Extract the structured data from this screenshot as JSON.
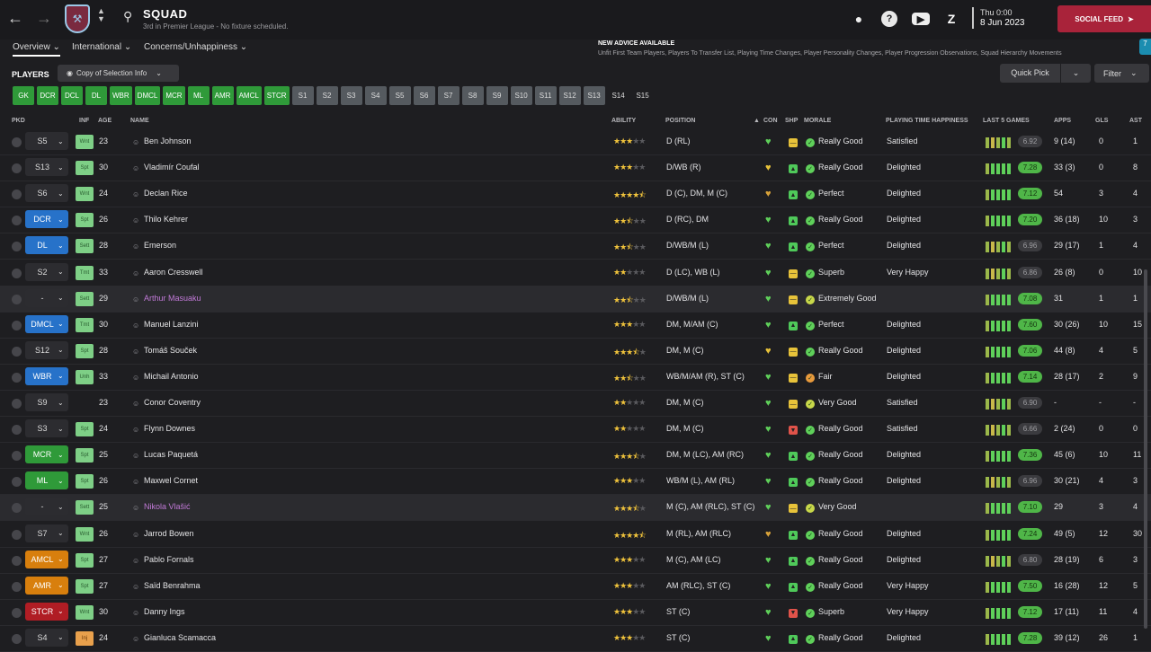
{
  "header": {
    "title": "SQUAD",
    "subtitle": "3rd in Premier League - No fixture scheduled.",
    "date_day": "Thu 0:00",
    "date_full": "8 Jun 2023",
    "social_feed": "SOCIAL FEED"
  },
  "tabs": [
    {
      "label": "Overview"
    },
    {
      "label": "International"
    },
    {
      "label": "Concerns/Unhappiness"
    }
  ],
  "advice": {
    "title": "NEW ADVICE AVAILABLE",
    "text": "Unfit First Team Players, Players To Transfer List, Playing Time Changes, Player Personality Changes, Player Progression Observations, Squad Hierarchy Movements",
    "count": "7"
  },
  "toolbar": {
    "players_label": "PLAYERS",
    "copy_label": "Copy of Selection Info",
    "quick_pick": "Quick Pick",
    "filter": "Filter"
  },
  "chips": [
    "GK",
    "DCR",
    "DCL",
    "DL",
    "WBR",
    "DMCL",
    "MCR",
    "ML",
    "AMR",
    "AMCL",
    "STCR",
    "S1",
    "S2",
    "S3",
    "S4",
    "S5",
    "S6",
    "S7",
    "S8",
    "S9",
    "S10",
    "S11",
    "S12",
    "S13",
    "S14",
    "S15"
  ],
  "columns": {
    "pkd": "PKD",
    "inf": "INF",
    "age": "AGE",
    "name": "NAME",
    "ability": "ABILITY",
    "position": "POSITION",
    "con": "CON",
    "shp": "SHP",
    "morale": "MORALE",
    "pth": "PLAYING TIME HAPPINESS",
    "last5": "LAST 5 GAMES",
    "apps": "APPS",
    "gls": "GLS",
    "ast": "AST"
  },
  "players": [
    {
      "pkd": "S5",
      "inf": "Wnt",
      "age": "23",
      "name": "Ben Johnson",
      "stars": 3,
      "position": "D (RL)",
      "morale": "Really Good",
      "pth": "Satisfied",
      "rating": "6.92",
      "apps": "9 (14)",
      "gls": "0",
      "ast": "1"
    },
    {
      "pkd": "S13",
      "inf": "Spt",
      "age": "30",
      "name": "Vladimír Coufal",
      "stars": 3,
      "position": "D/WB (R)",
      "morale": "Really Good",
      "pth": "Delighted",
      "rating": "7.28",
      "apps": "33 (3)",
      "gls": "0",
      "ast": "8"
    },
    {
      "pkd": "S6",
      "inf": "Wnt",
      "age": "24",
      "name": "Declan Rice",
      "stars": 4.5,
      "position": "D (C), DM, M (C)",
      "morale": "Perfect",
      "pth": "Delighted",
      "rating": "7.12",
      "apps": "54",
      "gls": "3",
      "ast": "4"
    },
    {
      "pkd": "DCR",
      "inf": "Spt",
      "age": "26",
      "name": "Thilo Kehrer",
      "stars": 2.5,
      "position": "D (RC), DM",
      "morale": "Really Good",
      "pth": "Delighted",
      "rating": "7.20",
      "apps": "36 (18)",
      "gls": "10",
      "ast": "3"
    },
    {
      "pkd": "DL",
      "inf": "Sett",
      "age": "28",
      "name": "Emerson",
      "stars": 2.5,
      "position": "D/WB/M (L)",
      "morale": "Perfect",
      "pth": "Delighted",
      "rating": "6.96",
      "apps": "29 (17)",
      "gls": "1",
      "ast": "4"
    },
    {
      "pkd": "S2",
      "inf": "Tmt",
      "age": "33",
      "name": "Aaron Cresswell",
      "stars": 2,
      "position": "D (LC), WB (L)",
      "morale": "Superb",
      "pth": "Very Happy",
      "rating": "6.86",
      "apps": "26 (8)",
      "gls": "0",
      "ast": "10"
    },
    {
      "pkd": "-",
      "inf": "Sett",
      "age": "29",
      "name": "Arthur Masuaku",
      "stars": 2.5,
      "position": "D/WB/M (L)",
      "morale": "Extremely Good",
      "pth": "",
      "rating": "7.08",
      "apps": "31",
      "gls": "1",
      "ast": "1"
    },
    {
      "pkd": "DMCL",
      "inf": "Tmt",
      "age": "30",
      "name": "Manuel Lanzini",
      "stars": 3,
      "position": "DM, M/AM (C)",
      "morale": "Perfect",
      "pth": "Delighted",
      "rating": "7.60",
      "apps": "30 (26)",
      "gls": "10",
      "ast": "15"
    },
    {
      "pkd": "S12",
      "inf": "Spt",
      "age": "28",
      "name": "Tomáš Souček",
      "stars": 3.5,
      "position": "DM, M (C)",
      "morale": "Really Good",
      "pth": "Delighted",
      "rating": "7.06",
      "apps": "44 (8)",
      "gls": "4",
      "ast": "5"
    },
    {
      "pkd": "WBR",
      "inf": "Unh",
      "age": "33",
      "name": "Michail Antonio",
      "stars": 2.5,
      "position": "WB/M/AM (R), ST (C)",
      "morale": "Fair",
      "pth": "Delighted",
      "rating": "7.14",
      "apps": "28 (17)",
      "gls": "2",
      "ast": "9"
    },
    {
      "pkd": "S9",
      "inf": "",
      "age": "23",
      "name": "Conor Coventry",
      "stars": 2,
      "position": "DM, M (C)",
      "morale": "Very Good",
      "pth": "Satisfied",
      "rating": "6.90",
      "apps": "-",
      "gls": "-",
      "ast": "-"
    },
    {
      "pkd": "S3",
      "inf": "Spt",
      "age": "24",
      "name": "Flynn Downes",
      "stars": 2,
      "position": "DM, M (C)",
      "morale": "Really Good",
      "pth": "Satisfied",
      "rating": "6.66",
      "apps": "2 (24)",
      "gls": "0",
      "ast": "0"
    },
    {
      "pkd": "MCR",
      "inf": "Spt",
      "age": "25",
      "name": "Lucas Paquetá",
      "stars": 3.5,
      "position": "DM, M (LC), AM (RC)",
      "morale": "Really Good",
      "pth": "Delighted",
      "rating": "7.36",
      "apps": "45 (6)",
      "gls": "10",
      "ast": "11"
    },
    {
      "pkd": "ML",
      "inf": "Spt",
      "age": "26",
      "name": "Maxwel Cornet",
      "stars": 3,
      "position": "WB/M (L), AM (RL)",
      "morale": "Really Good",
      "pth": "Delighted",
      "rating": "6.96",
      "apps": "30 (21)",
      "gls": "4",
      "ast": "3"
    },
    {
      "pkd": "-",
      "inf": "Sett",
      "age": "25",
      "name": "Nikola Vlašić",
      "stars": 3.5,
      "position": "M (C), AM (RLC), ST (C)",
      "morale": "Very Good",
      "pth": "",
      "rating": "7.10",
      "apps": "29",
      "gls": "3",
      "ast": "4"
    },
    {
      "pkd": "S7",
      "inf": "Wnt",
      "age": "26",
      "name": "Jarrod Bowen",
      "stars": 4.5,
      "position": "M (RL), AM (RLC)",
      "morale": "Really Good",
      "pth": "Delighted",
      "rating": "7.24",
      "apps": "49 (5)",
      "gls": "12",
      "ast": "30"
    },
    {
      "pkd": "AMCL",
      "inf": "Spt",
      "age": "27",
      "name": "Pablo Fornals",
      "stars": 3,
      "position": "M (C), AM (LC)",
      "morale": "Really Good",
      "pth": "Delighted",
      "rating": "6.80",
      "apps": "28 (19)",
      "gls": "6",
      "ast": "3"
    },
    {
      "pkd": "AMR",
      "inf": "Spt",
      "age": "27",
      "name": "Saïd Benrahma",
      "stars": 3,
      "position": "AM (RLC), ST (C)",
      "morale": "Really Good",
      "pth": "Very Happy",
      "rating": "7.50",
      "apps": "16 (28)",
      "gls": "12",
      "ast": "5"
    },
    {
      "pkd": "STCR",
      "inf": "Wnt",
      "age": "30",
      "name": "Danny Ings",
      "stars": 3,
      "position": "ST (C)",
      "morale": "Superb",
      "pth": "Very Happy",
      "rating": "7.12",
      "apps": "17 (11)",
      "gls": "11",
      "ast": "4"
    },
    {
      "pkd": "S4",
      "inf": "Inj",
      "age": "24",
      "name": "Gianluca Scamacca",
      "stars": 3,
      "position": "ST (C)",
      "morale": "Really Good",
      "pth": "Delighted",
      "rating": "7.28",
      "apps": "39 (12)",
      "gls": "26",
      "ast": "1"
    }
  ],
  "colors": {
    "accent": "#a9233a",
    "green": "#2f9a39",
    "blue": "#2772c9",
    "orange": "#d87f0d",
    "red": "#b01d24",
    "star": "#f0c33c",
    "loan": "#c27ad8"
  }
}
